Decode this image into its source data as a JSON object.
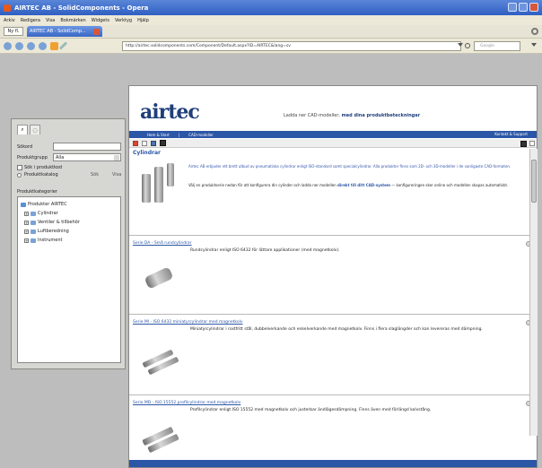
{
  "window": {
    "title": "AIRTEC AB - SolidComponents - Opera"
  },
  "menu": {
    "items": [
      "Arkiv",
      "Redigera",
      "Visa",
      "Bokmärken",
      "Widgets",
      "Verktyg",
      "Hjälp"
    ]
  },
  "tabs": {
    "newtab_label": "Ny fl.",
    "active_tab_label": "AIRTEC AB - SolidComp..."
  },
  "nav": {
    "address": "http://airtec.solidcomponents.com/Component/Default.aspx?ID=AIRTEC&lang=sv",
    "search_placeholder": "Google"
  },
  "sidebar": {
    "search_label": "Sökord",
    "search_value": "",
    "product_group_label": "Produktgrupp",
    "product_group_value": "Alla",
    "checkbox_label": "Sök i produktkod",
    "radio_label": "Produktkatalog",
    "search_button": "Sök",
    "reset_button": "Visa",
    "group_label": "Produktkategorier",
    "tree": [
      {
        "label": "Produkter AIRTEC",
        "child": false
      },
      {
        "label": "Cylindrar",
        "child": true
      },
      {
        "label": "Ventiler & tillbehör",
        "child": true
      },
      {
        "label": "Luftberedning",
        "child": true
      },
      {
        "label": "Instrument",
        "child": true
      }
    ]
  },
  "page": {
    "logo": "airtec",
    "tagline_pre": "Ladda ner CAD-modeller, ",
    "tagline_bold": "med dina produktbeteckningar",
    "nav_left": [
      "Hem & Start",
      "CAD-modeller"
    ],
    "nav_right": "Kontakt & Support",
    "section_title": "Cylindrar",
    "intro_text": "Airtec AB erbjuder ett brett utbud av pneumatiska cylindrar enligt ISO-standard samt specialcylindrar. Alla produkter finns som 2D- och 3D-modeller i de vanligaste CAD-formaten.",
    "intro_text2_pre": "Välj en produktserie nedan för att konfigurera din cylinder och ladda ner modellen ",
    "intro_text2_bold": "direkt till ditt CAD-system",
    "intro_text2_post": " — konfigureringen sker online och modellen skapas automatiskt.",
    "items": [
      {
        "title": "Serie DA - Små rundcylindrar",
        "desc": "Rundcylindrar enligt ISO 6432 för lättare applikationer (med magnetkolv)."
      },
      {
        "title": "Serie MI - ISO 6432 miniatyrcylindrar med magnetkolv",
        "desc": "Miniatyrcylindrar i rostfritt stål, dubbelverkande och enkelverkande med magnetkolv. Finns i flera slaglängder och kan levereras med dämpning."
      },
      {
        "title": "Serie MD - ISO 15552 profilcylindrar med magnetkolv",
        "desc": "Profilcylindrar enligt ISO 15552 med magnetkolv och justerbar ändlägesdämpning. Finns även med förlängd kolvstång."
      }
    ]
  }
}
